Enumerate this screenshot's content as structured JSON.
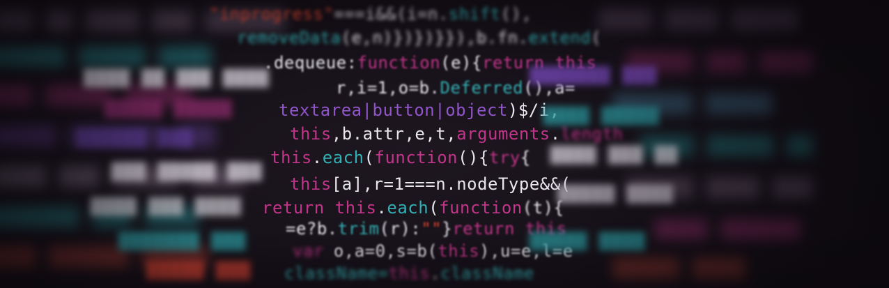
{
  "lines": [
    [
      "\"inprogress\"",
      "===i&&(i=n.",
      "shift",
      "(),"
    ],
    [
      "removeData",
      "(e,n)})})}}),b.fn.",
      "extend",
      "("
    ],
    [
      ".dequeue:",
      "function",
      "(e){",
      "return",
      "this"
    ],
    [
      "r,i=1,o=b.",
      "Deferred",
      "(),a="
    ],
    [
      "textarea|",
      "button",
      "|",
      "object",
      ")$/i,"
    ],
    [
      "this",
      ",b.attr,e,t,",
      "arguments",
      ".",
      "length"
    ],
    [
      "this",
      ".",
      "each",
      "(",
      "function",
      "(){",
      "try",
      "{"
    ],
    [
      "this",
      "[a],r=1===n.nodeType&&("
    ],
    [
      "return",
      "this",
      ".",
      "each",
      "(",
      "function",
      "(t){"
    ],
    [
      "=e?b.",
      "trim",
      "(r):",
      "\"\"",
      "}",
      "return",
      "this"
    ],
    [
      "o,a=0,s=b(",
      "this",
      "),u=e,l=e"
    ],
    [
      "className=",
      "this",
      ".",
      "className"
    ]
  ]
}
